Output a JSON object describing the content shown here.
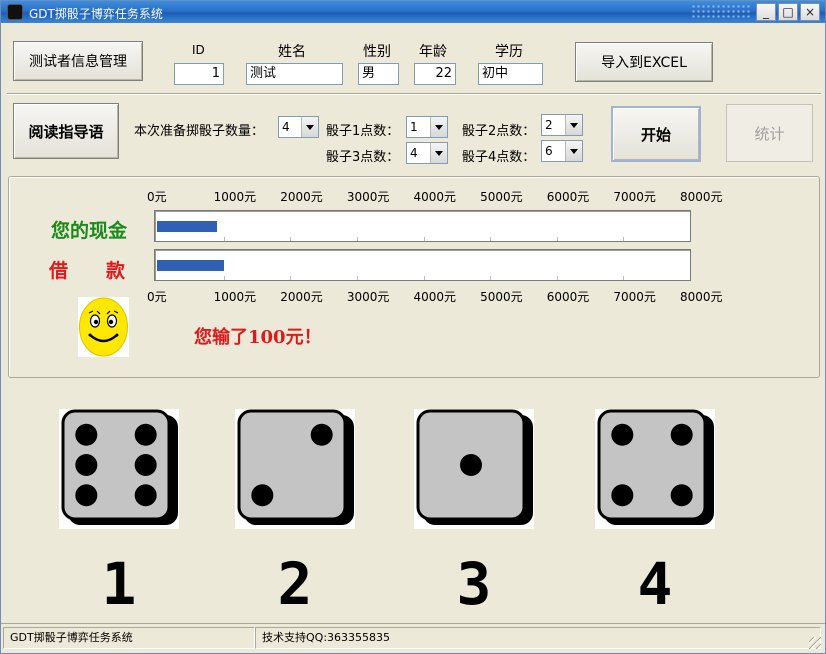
{
  "window": {
    "title": "GDT掷骰子博弈任务系统",
    "controls": {
      "minimize": "_",
      "maximize": "□",
      "close": "×"
    }
  },
  "toolbar": {
    "tester_info_button": "测试者信息管理",
    "export_button": "导入到EXCEL",
    "fields": {
      "id_label": "ID",
      "id_value": "1",
      "name_label": "姓名",
      "name_value": "测试",
      "gender_label": "性别",
      "gender_value": "男",
      "age_label": "年龄",
      "age_value": "22",
      "education_label": "学历",
      "education_value": "初中"
    }
  },
  "setup": {
    "read_guide_button": "阅读指导语",
    "dice_count_label": "本次准备掷骰子数量：",
    "dice_count_value": "4",
    "die1_label": "骰子1点数：",
    "die1_value": "1",
    "die2_label": "骰子2点数：",
    "die2_value": "2",
    "die3_label": "骰子3点数：",
    "die3_value": "4",
    "die4_label": "骰子4点数：",
    "die4_value": "6",
    "start_button": "开始",
    "stats_button": "统计"
  },
  "money": {
    "scale_ticks": [
      "0元",
      "1000元",
      "2000元",
      "3000元",
      "4000元",
      "5000元",
      "6000元",
      "7000元",
      "8000元"
    ],
    "scale_max": 8000,
    "cash_label": "您的现金",
    "cash_value": 900,
    "loan_label": "借　　款",
    "loan_value": 1000,
    "result_message": "您输了100元！",
    "colors": {
      "cash_label": "#1a8a1a",
      "loan_label": "#e01a1a",
      "bar": "#2f60b6"
    }
  },
  "dice": [
    {
      "label": "1",
      "face": 6
    },
    {
      "label": "2",
      "face": 2
    },
    {
      "label": "3",
      "face": 1
    },
    {
      "label": "4",
      "face": 4
    }
  ],
  "statusbar": {
    "app_name": "GDT掷骰子博弈任务系统",
    "support": "技术支持QQ:363355835"
  }
}
